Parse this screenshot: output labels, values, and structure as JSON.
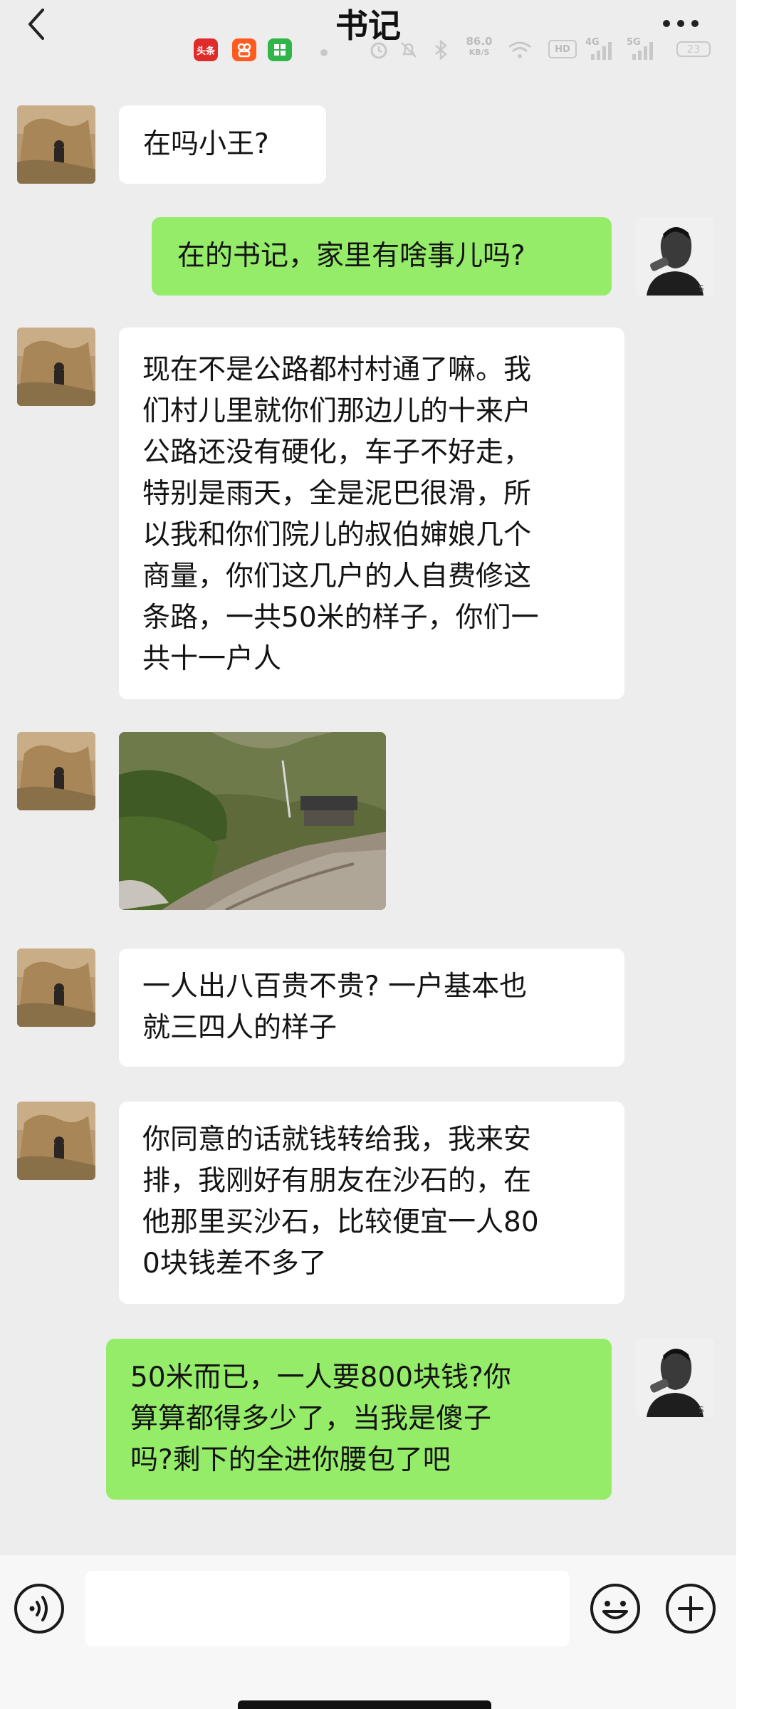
{
  "header": {
    "title": "书记",
    "back_icon": "chevron-left-icon",
    "more_icon": "more-horizontal-icon"
  },
  "status_bar": {
    "apps": [
      "头条",
      "快手",
      "小程序"
    ],
    "net_speed": "86.0",
    "net_speed_unit": "KB/S",
    "hd_label": "HD",
    "sig1_label": "4G",
    "sig2_label": "5G",
    "battery": "23"
  },
  "messages": [
    {
      "side": "left",
      "sender": "书记",
      "text": "在吗小王?"
    },
    {
      "side": "right",
      "sender": "小王",
      "text": "在的书记，家里有啥事儿吗?"
    },
    {
      "side": "left",
      "sender": "书记",
      "lines": [
        "现在不是公路都村村通了嘛。我",
        "们村儿里就你们那边儿的十来户",
        "公路还没有硬化，车子不好走，",
        "特别是雨天，全是泥巴很滑，所",
        "以我和你们院儿的叔伯婶娘几个",
        "商量，你们这几户的人自费修这",
        "条路，一共50米的样子，你们一",
        "共十一户人"
      ]
    },
    {
      "side": "left",
      "sender": "书记",
      "type": "image",
      "description": "dirt-road-photo"
    },
    {
      "side": "left",
      "sender": "书记",
      "lines": [
        "一人出八百贵不贵? 一户基本也",
        "就三四人的样子"
      ]
    },
    {
      "side": "left",
      "sender": "书记",
      "lines": [
        "你同意的话就钱转给我，我来安",
        "排，我刚好有朋友在沙石的，在",
        "他那里买沙石，比较便宜一人80",
        "0块钱差不多了"
      ]
    },
    {
      "side": "right",
      "sender": "小王",
      "lines": [
        "50米而已，一人要800块钱?你",
        "算算都得多少了，当我是傻子",
        "吗?剩下的全进你腰包了吧"
      ]
    }
  ],
  "input_bar": {
    "placeholder": "",
    "voice_icon": "voice-icon",
    "emoji_icon": "emoji-icon",
    "plus_icon": "plus-icon"
  },
  "colors": {
    "chat_bg": "#ededed",
    "bubble_self": "#95ec69",
    "bubble_other": "#ffffff"
  }
}
